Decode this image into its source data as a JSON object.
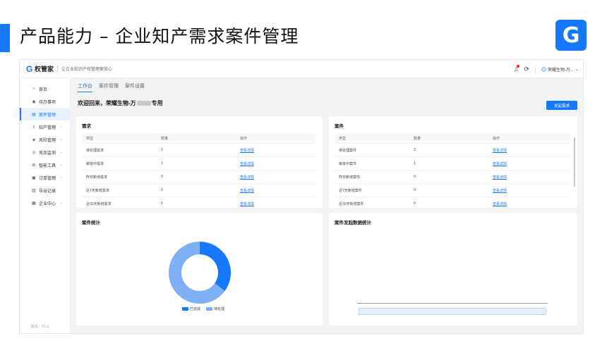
{
  "slide": {
    "title": "产品能力 – 企业知产需求案件管理",
    "logo_glyph": "G",
    "accent_color": "#1677ff"
  },
  "app": {
    "brand_name": "权管家",
    "brand_slogan": "让企业知识产权管理更放心",
    "user_name": "荣耀生物-万...",
    "bell_icon": "bell-icon",
    "settings_icon": "cycle-icon"
  },
  "sidebar": {
    "items": [
      {
        "label": "首页",
        "icon": "home-icon",
        "glyph": "⌂",
        "active": false,
        "expand": false
      },
      {
        "label": "待办事项",
        "icon": "todo-icon",
        "glyph": "◉",
        "active": false,
        "expand": false
      },
      {
        "label": "案件管理",
        "icon": "case-icon",
        "glyph": "▤",
        "active": true,
        "expand": false
      },
      {
        "label": "知产管理",
        "icon": "ip-icon",
        "glyph": "♗",
        "active": false,
        "expand": true
      },
      {
        "label": "风险管理",
        "icon": "risk-icon",
        "glyph": "◈",
        "active": false,
        "expand": true
      },
      {
        "label": "竞品监测",
        "icon": "monitor-icon",
        "glyph": "◎",
        "active": false,
        "expand": true
      },
      {
        "label": "智能工具",
        "icon": "tool-icon",
        "glyph": "⚙",
        "active": false,
        "expand": true
      },
      {
        "label": "订单管理",
        "icon": "order-icon",
        "glyph": "▣",
        "active": false,
        "expand": true
      },
      {
        "label": "导出记录",
        "icon": "export-icon",
        "glyph": "▥",
        "active": false,
        "expand": false
      },
      {
        "label": "企业中心",
        "icon": "company-icon",
        "glyph": "▦",
        "active": false,
        "expand": true
      }
    ],
    "footer": "版本：V1.0"
  },
  "main": {
    "tabs": [
      {
        "label": "工作台",
        "active": true
      },
      {
        "label": "案件管理",
        "active": false
      },
      {
        "label": "案件设置",
        "active": false
      }
    ],
    "welcome_prefix": "欢迎回来，荣耀生物-万",
    "welcome_suffix": "专用",
    "primary_button": "发起需求"
  },
  "demand_card": {
    "title": "需求",
    "headers": [
      "类型",
      "数量",
      "操作"
    ],
    "rows": [
      {
        "type": "待处理需求",
        "count": "1",
        "action": "查看详情"
      },
      {
        "type": "审批中需求",
        "count": "1",
        "action": "查看详情"
      },
      {
        "type": "昨日新增需求",
        "count": "0",
        "action": "查看详情"
      },
      {
        "type": "近7天新增需求",
        "count": "0",
        "action": "查看详情"
      },
      {
        "type": "近30天新增需求",
        "count": "0",
        "action": "查看详情"
      },
      {
        "type": "需求驳回数（近1天）",
        "count": "0",
        "action": "查看详情"
      }
    ]
  },
  "case_card": {
    "title": "案件",
    "headers": [
      "类型",
      "数量",
      "操作"
    ],
    "rows": [
      {
        "type": "待处理案件",
        "count": "2",
        "action": "查看详情"
      },
      {
        "type": "审批中案件",
        "count": "1",
        "action": "查看详情"
      },
      {
        "type": "昨日新增案件",
        "count": "0",
        "action": "查看详情"
      },
      {
        "type": "近7天新增案件",
        "count": "0",
        "action": "查看详情"
      },
      {
        "type": "近30天新增案件",
        "count": "0",
        "action": "查看详情"
      },
      {
        "type": "结案确认数（近1天）",
        "count": "0",
        "action": "查看详情"
      }
    ]
  },
  "stats_card": {
    "title": "案件统计",
    "legend": [
      {
        "label": "已完成",
        "color": "#1677ff"
      },
      {
        "label": "待处理",
        "color": "#7fb0f5"
      }
    ]
  },
  "launch_card": {
    "title": "案件发起数据统计"
  },
  "chart_data": [
    {
      "type": "pie",
      "title": "案件统计",
      "labels": [
        "已完成",
        "待处理"
      ],
      "values": [
        35,
        65
      ],
      "colors": [
        "#1677ff",
        "#7fb0f5"
      ],
      "donut": true,
      "legend": "bottom"
    },
    {
      "type": "bar",
      "title": "案件发起数据统计",
      "categories": [],
      "values": []
    }
  ]
}
